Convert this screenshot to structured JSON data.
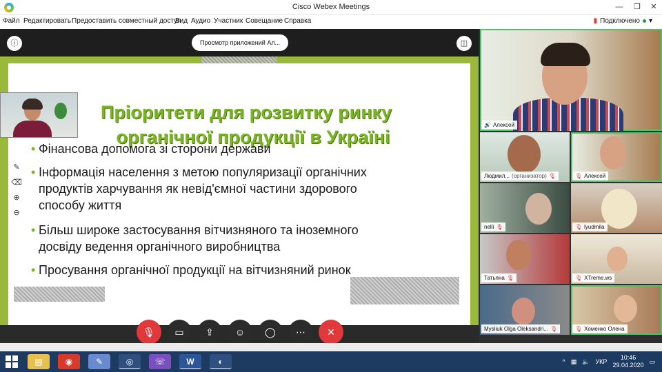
{
  "window": {
    "title": "Cisco Webex Meetings",
    "controls": {
      "minimize": "—",
      "maximize": "❐",
      "close": "✕"
    }
  },
  "menu": {
    "items": [
      "Файл",
      "Редактировать",
      "Предоставить совместный доступ",
      "Вид",
      "Аудио",
      "Участник",
      "Совещание",
      "Справка"
    ],
    "connection_status": "Подключено"
  },
  "share": {
    "viewing_label": "Просмотр приложений Ал...",
    "slide": {
      "title_line1": "Пріоритети для розвитку ринку",
      "title_line2": "органічної продукції в Україні",
      "bullets": [
        "Фінансова допомога зі сторони держави",
        "Інформація   населення   з   метою   популяризації   органічних",
        "продуктів   харчування   як   невід'ємної   частини   здорового",
        "способу життя",
        "Більш   широке   застосування     вітчизняного   та   іноземного",
        "досвіду ведення органічного виробництва",
        "Просування органічної продукції на вітчизняний ринок"
      ]
    }
  },
  "participants": {
    "active_speaker": "Алексей",
    "tiles": [
      {
        "name": "Людмил...",
        "role": "(организатор)"
      },
      {
        "name": "Алексей",
        "role": ""
      },
      {
        "name": "nelli",
        "role": ""
      },
      {
        "name": "lyudmila",
        "role": ""
      },
      {
        "name": "Татьяна",
        "role": ""
      },
      {
        "name": "XTreme.ws",
        "role": ""
      },
      {
        "name": "Mysliuk Olga Oleksandri...",
        "role": ""
      },
      {
        "name": "Хоменко Олена",
        "role": ""
      }
    ]
  },
  "taskbar": {
    "word_label": "W",
    "language": "УКР",
    "time": "10:46",
    "date": "29.04.2020"
  },
  "colors": {
    "slide_green": "#9ab83a",
    "title_green": "#7bb526",
    "end_call_red": "#e0383b",
    "taskbar_blue": "#1d3a60"
  }
}
